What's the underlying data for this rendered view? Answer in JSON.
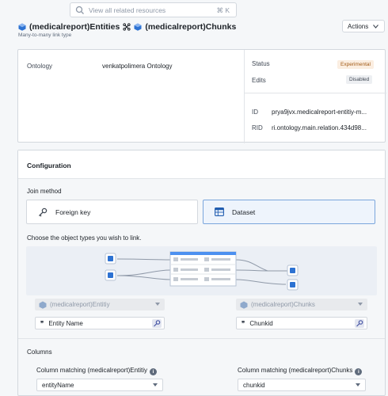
{
  "search": {
    "placeholder": "View all related resources",
    "shortcut": "⌘ K"
  },
  "header": {
    "left_type": "(medicalreport)Entities",
    "right_type": "(medicalreport)Chunks",
    "subtitle": "Many-to-many link type",
    "actions_label": "Actions"
  },
  "info": {
    "ontology_label": "Ontology",
    "ontology_value": "venkatpolimera Ontology",
    "status_label": "Status",
    "status_value": "Experimental",
    "edits_label": "Edits",
    "edits_value": "Disabled",
    "id_label": "ID",
    "id_value": "prya9jvx.medicalreport-entitiy-m...",
    "rid_label": "RID",
    "rid_value": "ri.ontology.main.relation.434d98..."
  },
  "configuration": {
    "title": "Configuration",
    "join_method_label": "Join method",
    "join_options": [
      {
        "label": "Foreign key",
        "selected": false
      },
      {
        "label": "Dataset",
        "selected": true
      }
    ],
    "choose_label": "Choose the object types you wish to link.",
    "left_object": {
      "type": "(medicalreport)Entitiy",
      "property": "Entity Name"
    },
    "right_object": {
      "type": "(medicalreport)Chunks",
      "property": "Chunkid"
    },
    "columns_label": "Columns",
    "left_column": {
      "label": "Column matching (medicalreport)Entitiy",
      "value": "entityName"
    },
    "right_column": {
      "label": "Column matching (medicalreport)Chunks",
      "value": "chunkid"
    }
  },
  "colors": {
    "accent": "#2d72d2",
    "experimental_bg": "#fbeee1",
    "experimental_text": "#a25b17"
  }
}
